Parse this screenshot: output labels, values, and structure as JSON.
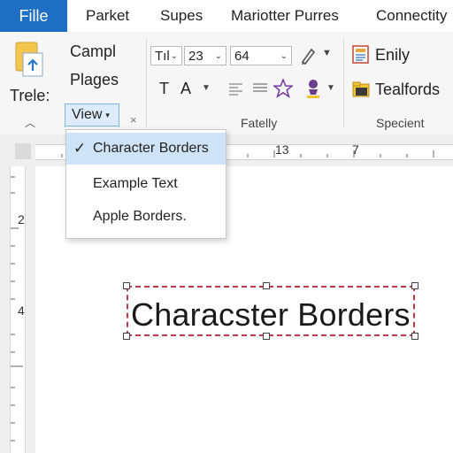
{
  "tabs": {
    "file": "Fille",
    "t1": "Parket",
    "t2": "Supes",
    "t3": "Mariotter Purres",
    "t4": "Connectity"
  },
  "ribbon": {
    "group1": {
      "label_top": "Trele:",
      "item_campl": "Campl",
      "item_plages": "Plages",
      "view_button": "View"
    },
    "font": {
      "font_name": "Tıl",
      "size1": "23",
      "size2": "64",
      "t_glyph": "T",
      "a_glyph": "A",
      "group_label": "Fatelly"
    },
    "right": {
      "item1": "Enily",
      "item2": "Tealfords",
      "group_label": "Specient"
    }
  },
  "ruler": {
    "top_numbers": [
      "13",
      "7"
    ],
    "left_numbers": [
      "2",
      "4"
    ]
  },
  "menu": {
    "items": [
      {
        "label": "Character Borders",
        "checked": true
      },
      {
        "label": "Example Text",
        "checked": false
      },
      {
        "label": "Apple Borders.",
        "checked": false
      }
    ]
  },
  "document": {
    "text": "Characster Borders",
    "border_color": "#c0394b"
  },
  "colors": {
    "accent": "#1e6fc4",
    "menu_highlight": "#cfe3f6"
  }
}
